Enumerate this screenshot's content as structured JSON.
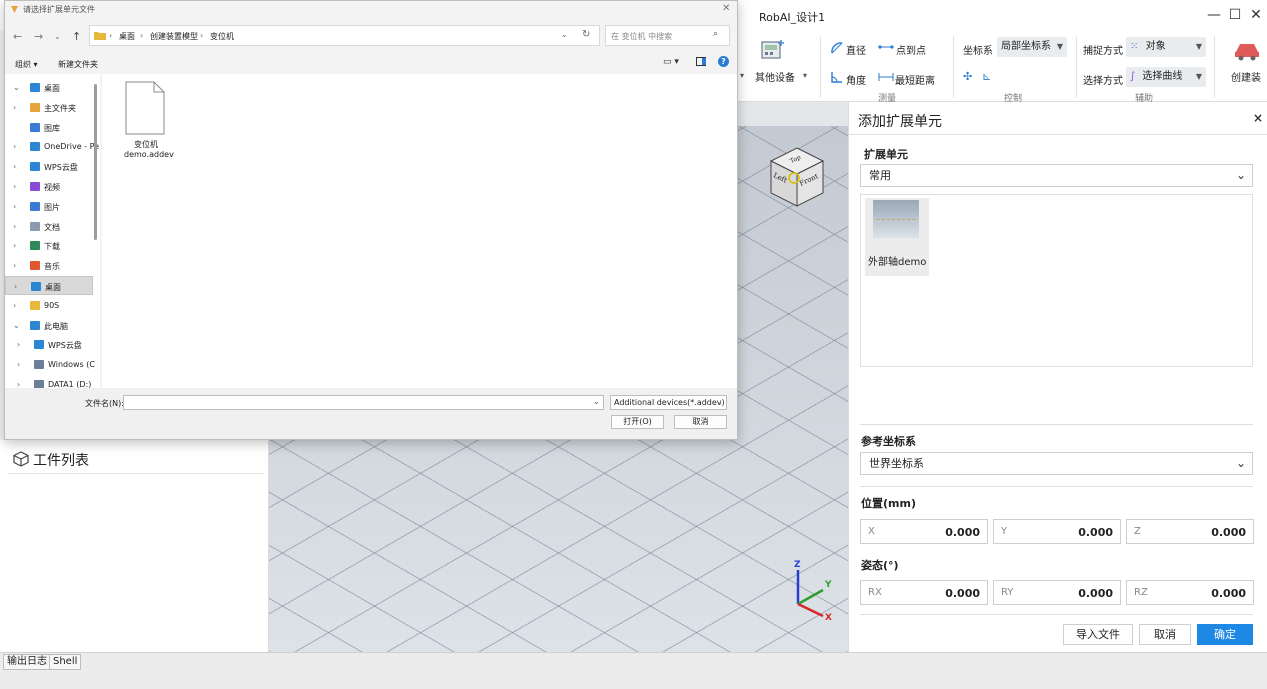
{
  "app": {
    "title": "RobAI_设计1",
    "window_controls": {
      "minimize": "—",
      "maximize": "☐",
      "close": "✕"
    }
  },
  "ribbon": {
    "other_devices": "其他设备",
    "measure": {
      "diameter": "直径",
      "point_to_point": "点到点",
      "angle": "角度",
      "shortest_distance": "最短距离",
      "group_label": "测量"
    },
    "control": {
      "coord_label": "坐标系",
      "coord_value": "局部坐标系",
      "group_label": "控制"
    },
    "assist": {
      "snap_label": "捕捉方式",
      "snap_value": "对象",
      "select_label": "选择方式",
      "select_value": "选择曲线",
      "group_label": "辅助"
    },
    "create": "创建装"
  },
  "dialog": {
    "title": "请选择扩展单元文件",
    "breadcrumb": [
      "桌面",
      "创建装置模型",
      "变位机"
    ],
    "search_placeholder": "在 变位机 中搜索",
    "toolbar": {
      "organize": "组织 ▾",
      "new_folder": "新建文件夹"
    },
    "tree": [
      {
        "label": "桌面",
        "exp": "⌄",
        "color": "#2b87d3",
        "indent": 0
      },
      {
        "label": "主文件夹",
        "exp": "›",
        "color": "#e8a33d",
        "indent": 1
      },
      {
        "label": "图库",
        "exp": "",
        "color": "#3a7bd5",
        "indent": 1
      },
      {
        "label": "OneDrive - Pe",
        "exp": "›",
        "color": "#2b87d3",
        "indent": 1
      },
      {
        "label": "WPS云盘",
        "exp": "›",
        "color": "#2b87d3",
        "indent": 1
      },
      {
        "label": "视频",
        "exp": "›",
        "color": "#8a4bd6",
        "indent": 1
      },
      {
        "label": "图片",
        "exp": "›",
        "color": "#3a7bd5",
        "indent": 1
      },
      {
        "label": "文档",
        "exp": "›",
        "color": "#8a9bb0",
        "indent": 1
      },
      {
        "label": "下载",
        "exp": "›",
        "color": "#2e8b57",
        "indent": 1
      },
      {
        "label": "音乐",
        "exp": "›",
        "color": "#e0572e",
        "indent": 1
      },
      {
        "label": "桌面",
        "exp": "›",
        "color": "#2b87d3",
        "indent": 1,
        "selected": true
      },
      {
        "label": "90S",
        "exp": "›",
        "color": "#e8b83d",
        "indent": 1
      },
      {
        "label": "此电脑",
        "exp": "⌄",
        "color": "#2b87d3",
        "indent": 0
      },
      {
        "label": "WPS云盘",
        "exp": "›",
        "color": "#2b87d3",
        "indent": 2
      },
      {
        "label": "Windows (C",
        "exp": "›",
        "color": "#6b7f99",
        "indent": 2
      },
      {
        "label": "DATA1 (D:)",
        "exp": "›",
        "color": "#6b7f99",
        "indent": 2
      }
    ],
    "files": [
      {
        "name_line1": "变位机",
        "name_line2": "demo.addev"
      }
    ],
    "footer": {
      "filename_label": "文件名(N):",
      "filename_value": "",
      "filter": "Additional devices(*.addev)",
      "open": "打开(O)",
      "cancel": "取消"
    }
  },
  "left_panel": {
    "title": "工件列表"
  },
  "viewport": {
    "cube": {
      "top": "Top",
      "left": "Left",
      "front": "Front"
    },
    "axes": {
      "x": "X",
      "y": "Y",
      "z": "Z"
    }
  },
  "right_panel": {
    "title": "添加扩展单元",
    "close": "×",
    "ext_unit_label": "扩展单元",
    "ext_unit_value": "常用",
    "items": [
      {
        "label": "外部轴demo"
      }
    ],
    "ref_coord_label": "参考坐标系",
    "ref_coord_value": "世界坐标系",
    "position_label": "位置(mm)",
    "position": [
      {
        "label": "X",
        "value": "0.000"
      },
      {
        "label": "Y",
        "value": "0.000"
      },
      {
        "label": "Z",
        "value": "0.000"
      }
    ],
    "attitude_label": "姿态(°)",
    "attitude": [
      {
        "label": "RX",
        "value": "0.000"
      },
      {
        "label": "RY",
        "value": "0.000"
      },
      {
        "label": "RZ",
        "value": "0.000"
      }
    ],
    "buttons": {
      "import": "导入文件",
      "cancel": "取消",
      "confirm": "确定"
    }
  },
  "bottom": {
    "tabs": [
      "输出日志",
      "Shell"
    ]
  }
}
